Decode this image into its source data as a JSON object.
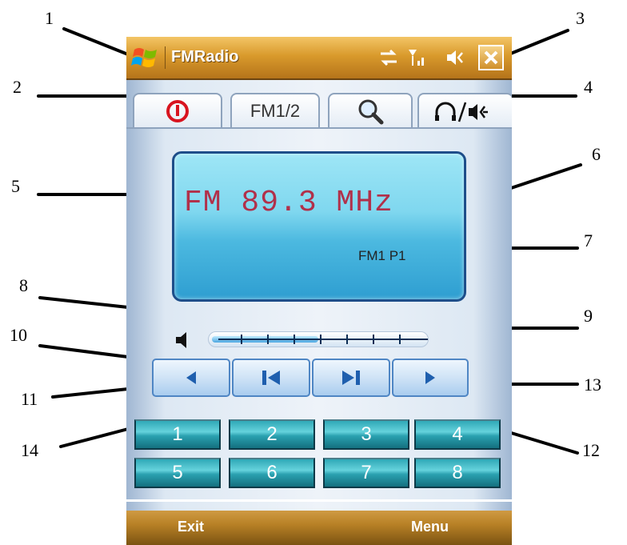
{
  "window": {
    "title": "FMRadio",
    "close_symbol": "✕",
    "accent_color": "#d99a2c"
  },
  "status_icons": [
    "sync-icon",
    "signal-icon",
    "speaker-muted-icon"
  ],
  "tabs": [
    {
      "label": "",
      "icon": "power-icon"
    },
    {
      "label": "FM1/2",
      "icon": ""
    },
    {
      "label": "",
      "icon": "search-icon"
    },
    {
      "label": "",
      "icon": "headphone-speaker-icon"
    }
  ],
  "display": {
    "frequency": "FM 89.3 MHz",
    "band_preset": "FM1 P1"
  },
  "volume": {
    "level": 0.5
  },
  "transport": [
    "seek-back-icon",
    "previous-station-icon",
    "next-station-icon",
    "seek-forward-icon"
  ],
  "presets": [
    "1",
    "2",
    "3",
    "4",
    "5",
    "6",
    "7",
    "8"
  ],
  "softkeys": {
    "left": "Exit",
    "right": "Menu"
  },
  "callouts": [
    "1",
    "2",
    "3",
    "4",
    "5",
    "6",
    "7",
    "8",
    "9",
    "10",
    "11",
    "12",
    "13",
    "14"
  ]
}
